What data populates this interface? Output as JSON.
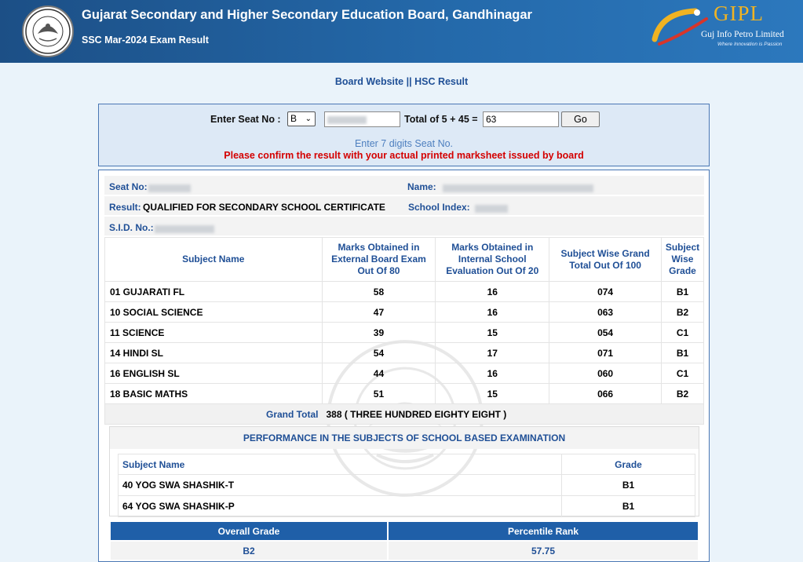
{
  "header": {
    "title": "Gujarat Secondary and Higher Secondary Education Board, Gandhinagar",
    "subtitle": "SSC Mar-2024 Exam Result",
    "partner_name": "GIPL",
    "partner_full": "Guj Info Petro Limited",
    "partner_tagline": "Where Innovation is Passion"
  },
  "links": {
    "board": "Board Website",
    "separator": "||",
    "hsc": "HSC Result"
  },
  "search": {
    "seat_label": "Enter Seat No :",
    "series_value": "B",
    "captcha_label": "Total of 5 + 45 =",
    "captcha_value": "63",
    "go_label": "Go",
    "hint": "Enter 7 digits Seat No.",
    "warning": "Please confirm the result with your actual printed marksheet issued by board"
  },
  "result": {
    "seat_label": "Seat No:",
    "name_label": "Name:",
    "result_label": "Result:",
    "result_value": "QUALIFIED FOR SECONDARY SCHOOL CERTIFICATE",
    "school_label": "School Index:",
    "sid_label": "S.I.D. No.:",
    "columns": [
      "Subject Name",
      "Marks Obtained in External Board Exam Out Of 80",
      "Marks Obtained in Internal School Evaluation Out Of 20",
      "Subject Wise Grand Total Out Of 100",
      "Subject Wise Grade"
    ],
    "subjects": [
      {
        "name": "01 GUJARATI FL",
        "ext": "58",
        "int": "16",
        "total": "074",
        "grade": "B1"
      },
      {
        "name": "10 SOCIAL SCIENCE",
        "ext": "47",
        "int": "16",
        "total": "063",
        "grade": "B2"
      },
      {
        "name": "11 SCIENCE",
        "ext": "39",
        "int": "15",
        "total": "054",
        "grade": "C1"
      },
      {
        "name": "14 HINDI SL",
        "ext": "54",
        "int": "17",
        "total": "071",
        "grade": "B1"
      },
      {
        "name": "16 ENGLISH SL",
        "ext": "44",
        "int": "16",
        "total": "060",
        "grade": "C1"
      },
      {
        "name": "18 BASIC MATHS",
        "ext": "51",
        "int": "15",
        "total": "066",
        "grade": "B2"
      }
    ],
    "grand_total_label": "Grand Total",
    "grand_total_value": "388 ( THREE HUNDRED EIGHTY EIGHT )"
  },
  "performance": {
    "heading": "PERFORMANCE IN THE SUBJECTS OF SCHOOL BASED EXAMINATION",
    "col_subject": "Subject Name",
    "col_grade": "Grade",
    "rows": [
      {
        "name": "40 YOG SWA SHASHIK-T",
        "grade": "B1"
      },
      {
        "name": "64 YOG SWA SHASHIK-P",
        "grade": "B1"
      }
    ]
  },
  "overall": {
    "grade_label": "Overall Grade",
    "grade_value": "B2",
    "percentile_label": "Percentile Rank",
    "percentile_value": "57.75"
  }
}
